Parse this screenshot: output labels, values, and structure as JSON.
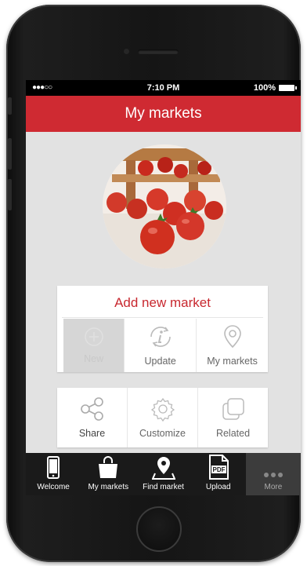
{
  "status_bar": {
    "signal": "●●●○○",
    "time": "7:10 PM",
    "battery": "100%"
  },
  "header": {
    "title": "My markets"
  },
  "card_main": {
    "title": "Add new market",
    "buttons": [
      {
        "label": "New",
        "icon": "add-icon"
      },
      {
        "label": "Update",
        "icon": "info-refresh-icon"
      },
      {
        "label": "My markets",
        "icon": "map-pin-icon"
      }
    ]
  },
  "card_secondary": {
    "buttons": [
      {
        "label": "Share",
        "icon": "share-icon"
      },
      {
        "label": "Customize",
        "icon": "gear-icon"
      },
      {
        "label": "Related",
        "icon": "stack-icon"
      }
    ]
  },
  "tab_bar": {
    "tabs": [
      {
        "label": "Welcome",
        "icon": "phone-icon"
      },
      {
        "label": "My markets",
        "icon": "shopping-bag-icon"
      },
      {
        "label": "Find market",
        "icon": "location-icon"
      },
      {
        "label": "Upload",
        "icon": "pdf-icon",
        "badge": "PDF"
      },
      {
        "label": "More",
        "icon": "more-dots-icon"
      }
    ]
  },
  "colors": {
    "accent": "#cf2a32",
    "tab_bar": "#1a1a1a",
    "screen_bg": "#e2e2e2"
  }
}
